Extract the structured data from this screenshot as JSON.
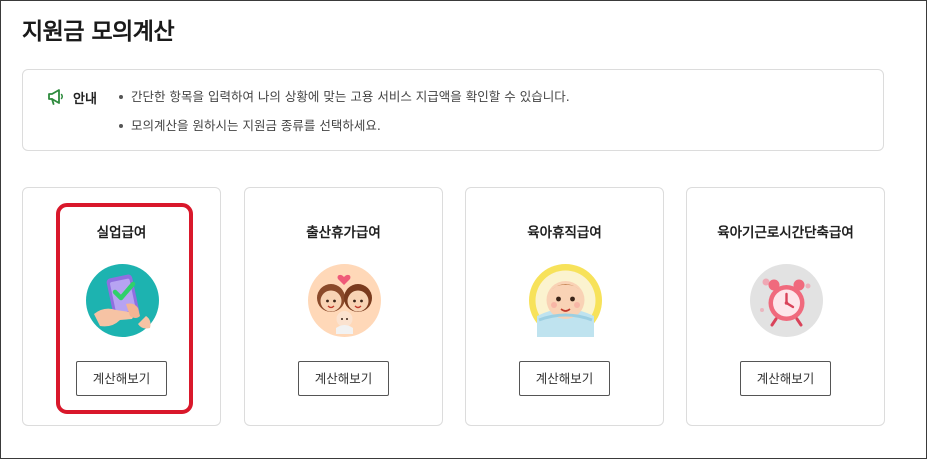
{
  "page": {
    "title": "지원금 모의계산"
  },
  "notice": {
    "label": "안내",
    "icon": "megaphone-icon",
    "lines": [
      "간단한 항목을 입력하여 나의 상황에 맞는 고용 서비스 지급액을 확인할 수 있습니다.",
      "모의계산을 원하시는 지원금 종류를 선택하세요."
    ]
  },
  "cards": [
    {
      "title": "실업급여",
      "icon": "phone-check-illustration",
      "button_label": "계산해보기",
      "accent": "#1db3b0",
      "highlighted": true
    },
    {
      "title": "출산휴가급여",
      "icon": "parents-baby-illustration",
      "button_label": "계산해보기",
      "accent": "#ffd8b8"
    },
    {
      "title": "육아휴직급여",
      "icon": "baby-face-illustration",
      "button_label": "계산해보기",
      "accent": "#f7e25a"
    },
    {
      "title": "육아기근로시간단축급여",
      "icon": "alarm-clock-illustration",
      "button_label": "계산해보기",
      "accent": "#e2e2e2"
    }
  ],
  "colors": {
    "highlight_border": "#d9182b",
    "notice_icon": "#2e8b3e",
    "card_border": "#dcdcdc"
  }
}
